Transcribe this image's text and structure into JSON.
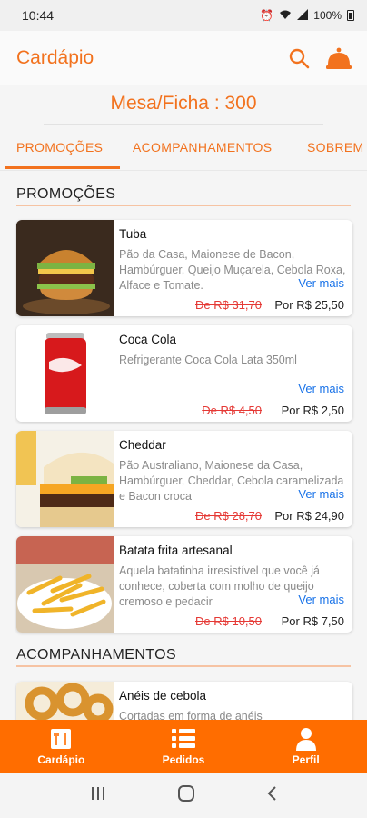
{
  "status": {
    "time": "10:44",
    "battery": "100%"
  },
  "appbar": {
    "title": "Cardápio",
    "icons": [
      "search-icon",
      "service-bell-icon"
    ]
  },
  "mesa": {
    "label": "Mesa/Ficha : 300"
  },
  "tabs": [
    {
      "label": "PROMOÇÕES"
    },
    {
      "label": "ACOMPANHAMENTOS"
    },
    {
      "label": "SOBREM"
    }
  ],
  "sections": [
    {
      "title": "PROMOÇÕES"
    },
    {
      "title": "ACOMPANHAMENTOS"
    }
  ],
  "ver_mais": "Ver mais",
  "promo_items": [
    {
      "name": "Tuba",
      "description": "Pão da Casa, Maionese de Bacon, Hambúrguer, Queijo Muçarela, Cebola Roxa, Alface e Tomate.",
      "old_price": "De R$ 31,70",
      "new_price": "Por R$ 25,50"
    },
    {
      "name": "Coca Cola",
      "description": "Refrigerante Coca Cola Lata 350ml",
      "old_price": "De R$ 4,50",
      "new_price": "Por R$ 2,50"
    },
    {
      "name": "Cheddar",
      "description": "Pão Australiano, Maionese da Casa, Hambúrguer, Cheddar, Cebola caramelizada e Bacon croca",
      "old_price": "De R$ 28,70",
      "new_price": "Por R$ 24,90"
    },
    {
      "name": "Batata frita artesanal",
      "description": "Aquela batatinha irresistível que você já conhece, coberta com molho de queijo cremoso e pedacir",
      "old_price": "De R$ 10,50",
      "new_price": "Por R$ 7,50"
    }
  ],
  "side_items": [
    {
      "name": "Anéis de cebola",
      "description": "Cortadas em forma de anéis"
    }
  ],
  "bottom_nav": [
    {
      "label": "Cardápio"
    },
    {
      "label": "Pedidos"
    },
    {
      "label": "Perfil"
    }
  ],
  "colors": {
    "accent": "#f2721e",
    "nav_bg": "#ff6d00",
    "old_price": "#e53935",
    "link": "#1a73e8"
  }
}
